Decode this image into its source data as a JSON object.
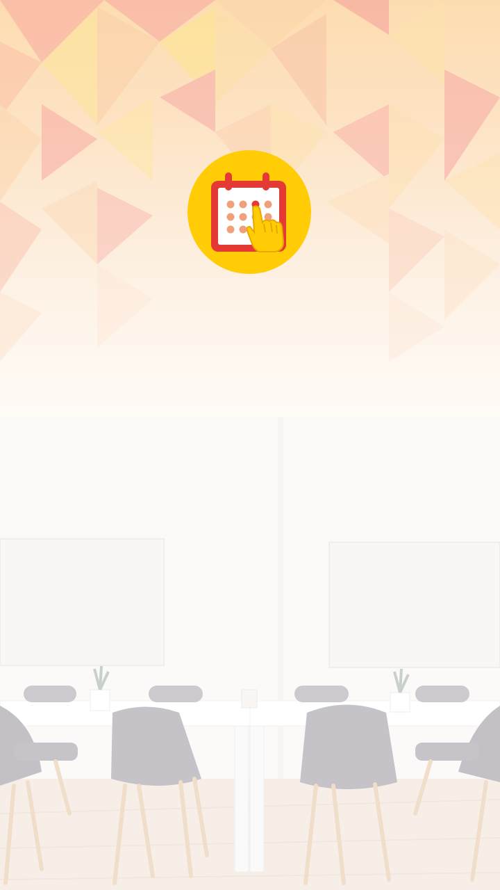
{
  "splash": {
    "logo_icon": "calendar-tap-icon",
    "background_image": "classroom-with-chairs",
    "colors": {
      "logo_circle": "#ffcc05",
      "calendar_red": "#e53935",
      "dots": "#f0a07a",
      "hand": "#ffcc05"
    }
  }
}
